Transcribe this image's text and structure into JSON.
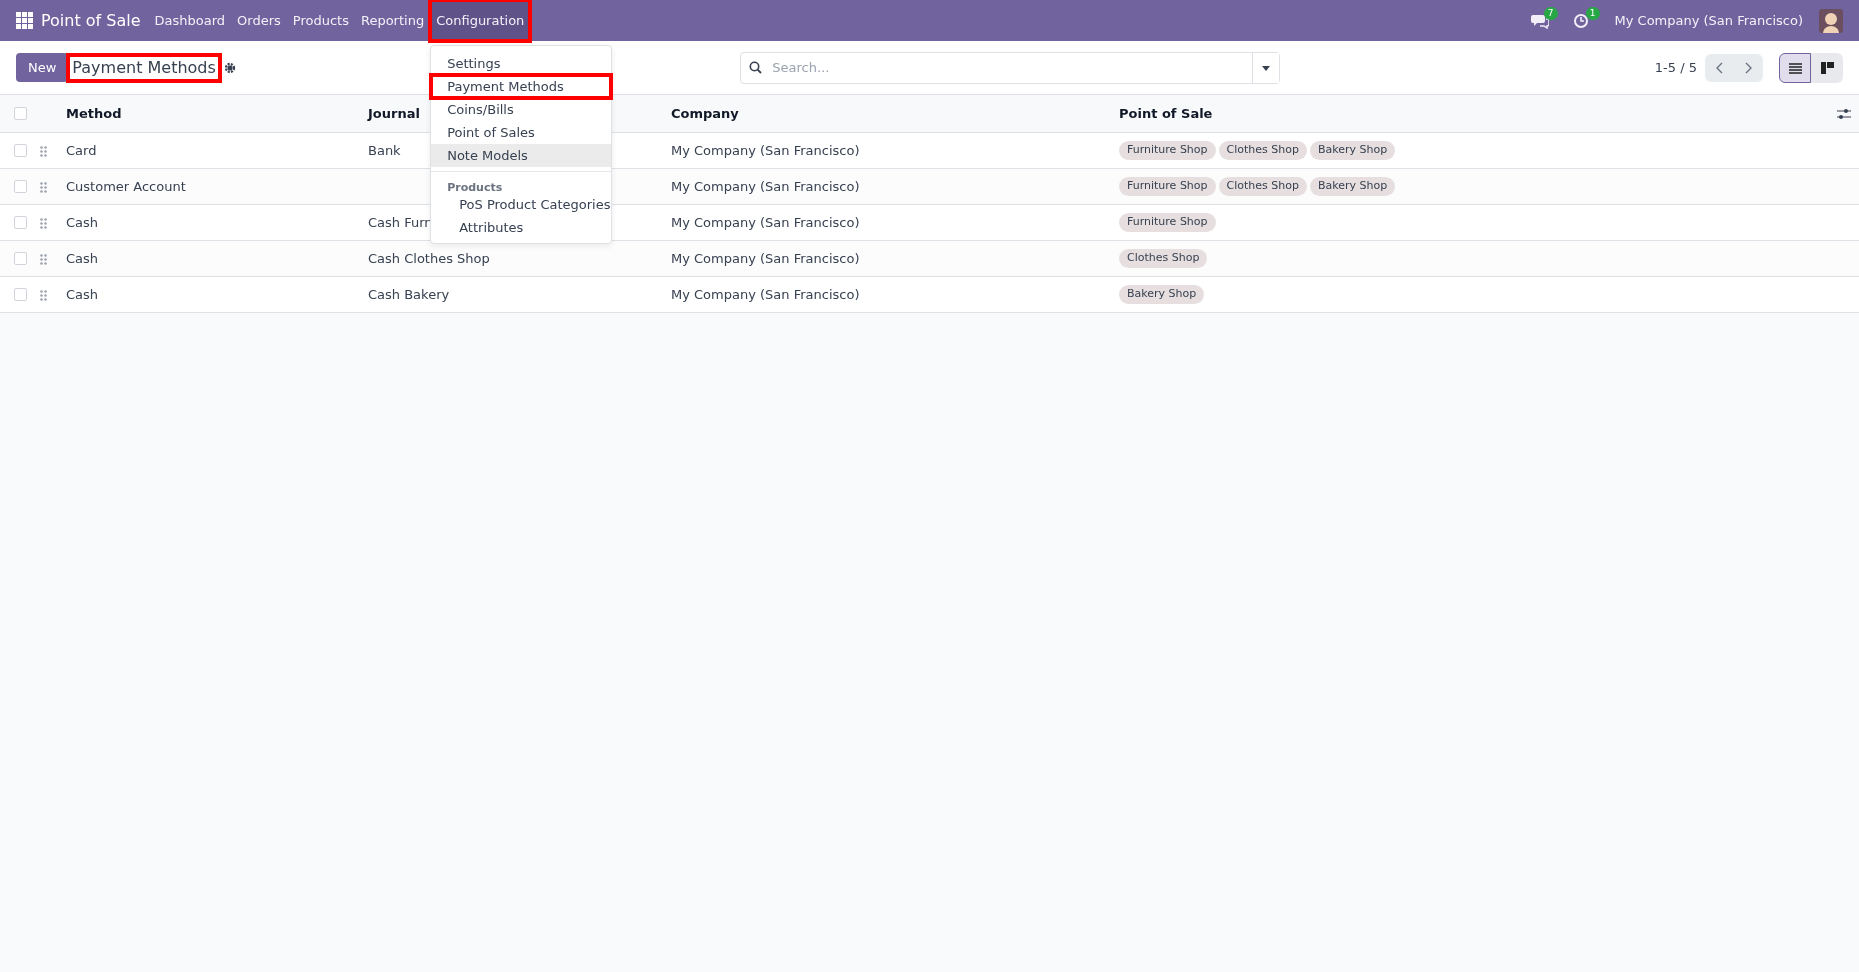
{
  "navbar": {
    "app_name": "Point of Sale",
    "menus": [
      {
        "label": "Dashboard",
        "selected": false,
        "highlighted": false
      },
      {
        "label": "Orders",
        "selected": false,
        "highlighted": false
      },
      {
        "label": "Products",
        "selected": false,
        "highlighted": false
      },
      {
        "label": "Reporting",
        "selected": false,
        "highlighted": false
      },
      {
        "label": "Configuration",
        "selected": true,
        "highlighted": true
      }
    ],
    "messages_count": "7",
    "activities_count": "1",
    "company": "My Company (San Francisco)"
  },
  "control_panel": {
    "new_button": "New",
    "title": "Payment Methods",
    "title_highlighted": true,
    "search": {
      "placeholder": "Search..."
    },
    "pager": "1-5 / 5",
    "views": [
      {
        "kind": "list",
        "selected": true
      },
      {
        "kind": "kanban",
        "selected": false
      }
    ]
  },
  "dropdown": {
    "items": [
      {
        "kind": "item",
        "label": "Settings",
        "hovered": false,
        "highlighted": false
      },
      {
        "kind": "item",
        "label": "Payment Methods",
        "hovered": false,
        "highlighted": true
      },
      {
        "kind": "item",
        "label": "Coins/Bills",
        "hovered": false,
        "highlighted": false
      },
      {
        "kind": "item",
        "label": "Point of Sales",
        "hovered": false,
        "highlighted": false
      },
      {
        "kind": "item",
        "label": "Note Models",
        "hovered": true,
        "highlighted": false
      },
      {
        "kind": "header",
        "label": "Products"
      },
      {
        "kind": "subitem",
        "label": "PoS Product Categories",
        "hovered": false,
        "highlighted": false
      },
      {
        "kind": "subitem",
        "label": "Attributes",
        "hovered": false,
        "highlighted": false
      }
    ]
  },
  "table": {
    "select_all_checked": false,
    "columns": [
      "Method",
      "Journal",
      "Company",
      "Point of Sale"
    ],
    "rows": [
      {
        "checked": false,
        "method": "Card",
        "journal": "Bank",
        "company": "My Company (San Francisco)",
        "point_of_sale": [
          "Furniture Shop",
          "Clothes Shop",
          "Bakery Shop"
        ]
      },
      {
        "checked": false,
        "method": "Customer Account",
        "company": "My Company (San Francisco)",
        "point_of_sale": [
          "Furniture Shop",
          "Clothes Shop",
          "Bakery Shop"
        ]
      },
      {
        "checked": false,
        "method": "Cash",
        "journal": "Cash Furn",
        "company": "My Company (San Francisco)",
        "point_of_sale": [
          "Furniture Shop"
        ]
      },
      {
        "checked": false,
        "method": "Cash",
        "journal": "Cash Clothes Shop",
        "company": "My Company (San Francisco)",
        "point_of_sale": [
          "Clothes Shop"
        ]
      },
      {
        "checked": false,
        "method": "Cash",
        "journal": "Cash Bakery",
        "company": "My Company (San Francisco)",
        "point_of_sale": [
          "Bakery Shop"
        ]
      }
    ]
  }
}
